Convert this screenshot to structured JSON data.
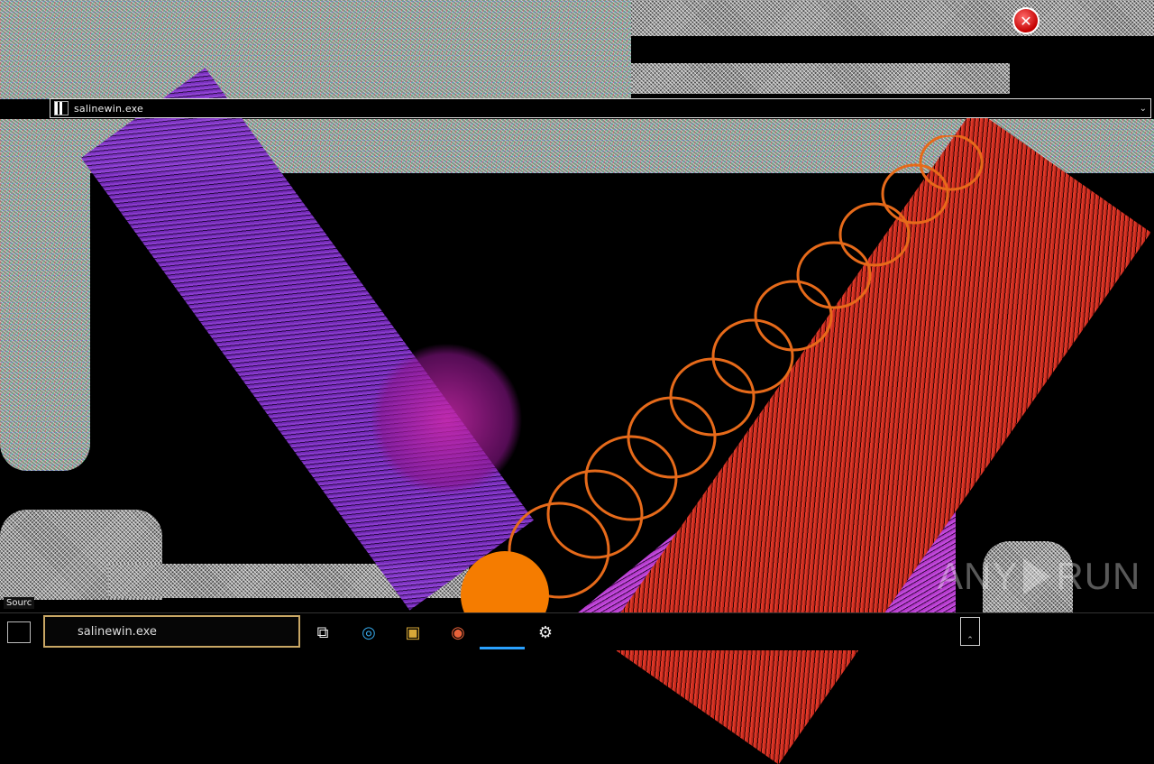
{
  "window": {
    "title": "salinewin.exe",
    "collapse_glyph": "⌄"
  },
  "close_button": {
    "glyph": "✕",
    "color": "#c40000"
  },
  "watermark": {
    "left": "ANY",
    "right": "RUN"
  },
  "taskbar": {
    "search_text": "salinewin.exe",
    "icons": [
      "task-view-icon",
      "edge-icon",
      "file-explorer-icon",
      "firefox-icon",
      "app-icon",
      "settings-icon"
    ],
    "glyphs": {
      "task_view": "⧉",
      "edge": "◎",
      "explorer": "▣",
      "firefox": "◉",
      "settings": "⚙"
    },
    "tray_label": "⌃",
    "small_label": "Sourc"
  },
  "colors": {
    "purple": "#7a2cc2",
    "magenta": "#b43acb",
    "red": "#c5281c",
    "orange": "#f57c00",
    "accent": "#2aa1ff"
  }
}
